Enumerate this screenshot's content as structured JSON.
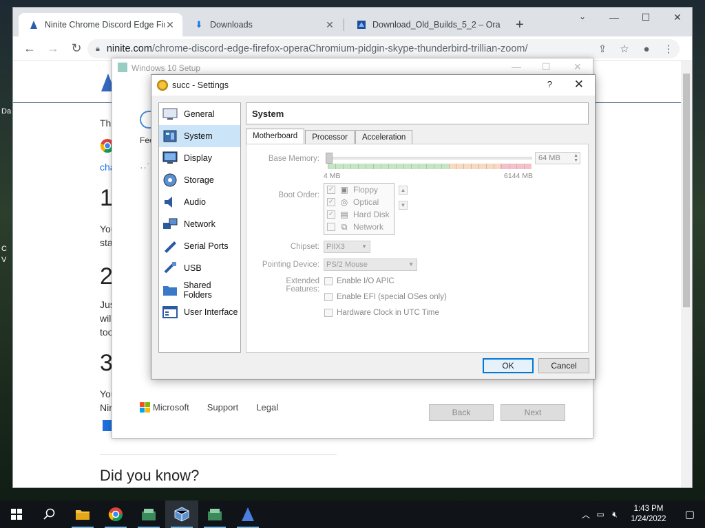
{
  "desktop": {
    "peek1": "Da",
    "peek2": "C",
    "peek3": "V"
  },
  "browser": {
    "tabs": [
      {
        "title": "Ninite Chrome Discord Edge Fire",
        "icon": "ninite-icon"
      },
      {
        "title": "Downloads",
        "icon": "download-icon"
      },
      {
        "title": "Download_Old_Builds_5_2 – Ora",
        "icon": "virtualbox-icon"
      }
    ],
    "url_host": "ninite.com",
    "url_path": "/chrome-discord-edge-firefox-operaChromium-pidgin-skype-thunderbird-trillian-zoom/"
  },
  "page": {
    "line1": "Thi",
    "line2": "Fee",
    "link": "cha",
    "n1": "1",
    "p1a": "You",
    "p1b": "sta",
    "n2": "2",
    "p2a": "Jus",
    "p2b": "will",
    "p2c": "too",
    "n3": "3",
    "p3a": "You",
    "p3b": "Nin",
    "did_you_know": "Did you know?"
  },
  "setup": {
    "title": "Windows 10 Setup",
    "brand": "Microsoft",
    "support": "Support",
    "legal": "Legal",
    "back": "Back",
    "next": "Next"
  },
  "settings": {
    "title": "succ - Settings",
    "help": "?",
    "nav": [
      {
        "label": "General",
        "icon": "general-icon"
      },
      {
        "label": "System",
        "icon": "system-icon",
        "selected": true
      },
      {
        "label": "Display",
        "icon": "display-icon"
      },
      {
        "label": "Storage",
        "icon": "storage-icon"
      },
      {
        "label": "Audio",
        "icon": "audio-icon"
      },
      {
        "label": "Network",
        "icon": "network-icon"
      },
      {
        "label": "Serial Ports",
        "icon": "serial-ports-icon"
      },
      {
        "label": "USB",
        "icon": "usb-icon"
      },
      {
        "label": "Shared Folders",
        "icon": "shared-folders-icon"
      },
      {
        "label": "User Interface",
        "icon": "user-interface-icon"
      }
    ],
    "section_title": "System",
    "tabs": [
      "Motherboard",
      "Processor",
      "Acceleration"
    ],
    "base_memory_label": "Base Memory:",
    "base_memory_value": "64 MB",
    "base_memory_fraction": 0.0,
    "mem_min": "4 MB",
    "mem_max": "6144 MB",
    "boot_order_label": "Boot Order:",
    "boot_items": [
      {
        "label": "Floppy",
        "checked": true,
        "icon": "floppy-icon"
      },
      {
        "label": "Optical",
        "checked": true,
        "icon": "optical-icon"
      },
      {
        "label": "Hard Disk",
        "checked": true,
        "icon": "hard-disk-icon"
      },
      {
        "label": "Network",
        "checked": false,
        "icon": "network-boot-icon"
      }
    ],
    "chipset_label": "Chipset:",
    "chipset_value": "PIIX3",
    "pointing_label": "Pointing Device:",
    "pointing_value": "PS/2 Mouse",
    "extended_label": "Extended Features:",
    "features": [
      {
        "label": "Enable I/O APIC",
        "checked": false
      },
      {
        "label": "Enable EFI (special OSes only)",
        "checked": false
      },
      {
        "label": "Hardware Clock in UTC Time",
        "checked": false
      }
    ],
    "ok": "OK",
    "cancel": "Cancel"
  },
  "taskbar": {
    "items": [
      "start-icon",
      "search-icon",
      "file-explorer-icon",
      "chrome-icon",
      "vm-app-icon",
      "virtualbox-icon",
      "vm-app-icon-2",
      "ninite-icon"
    ],
    "time": "1:43 PM",
    "date": "1/24/2022"
  }
}
